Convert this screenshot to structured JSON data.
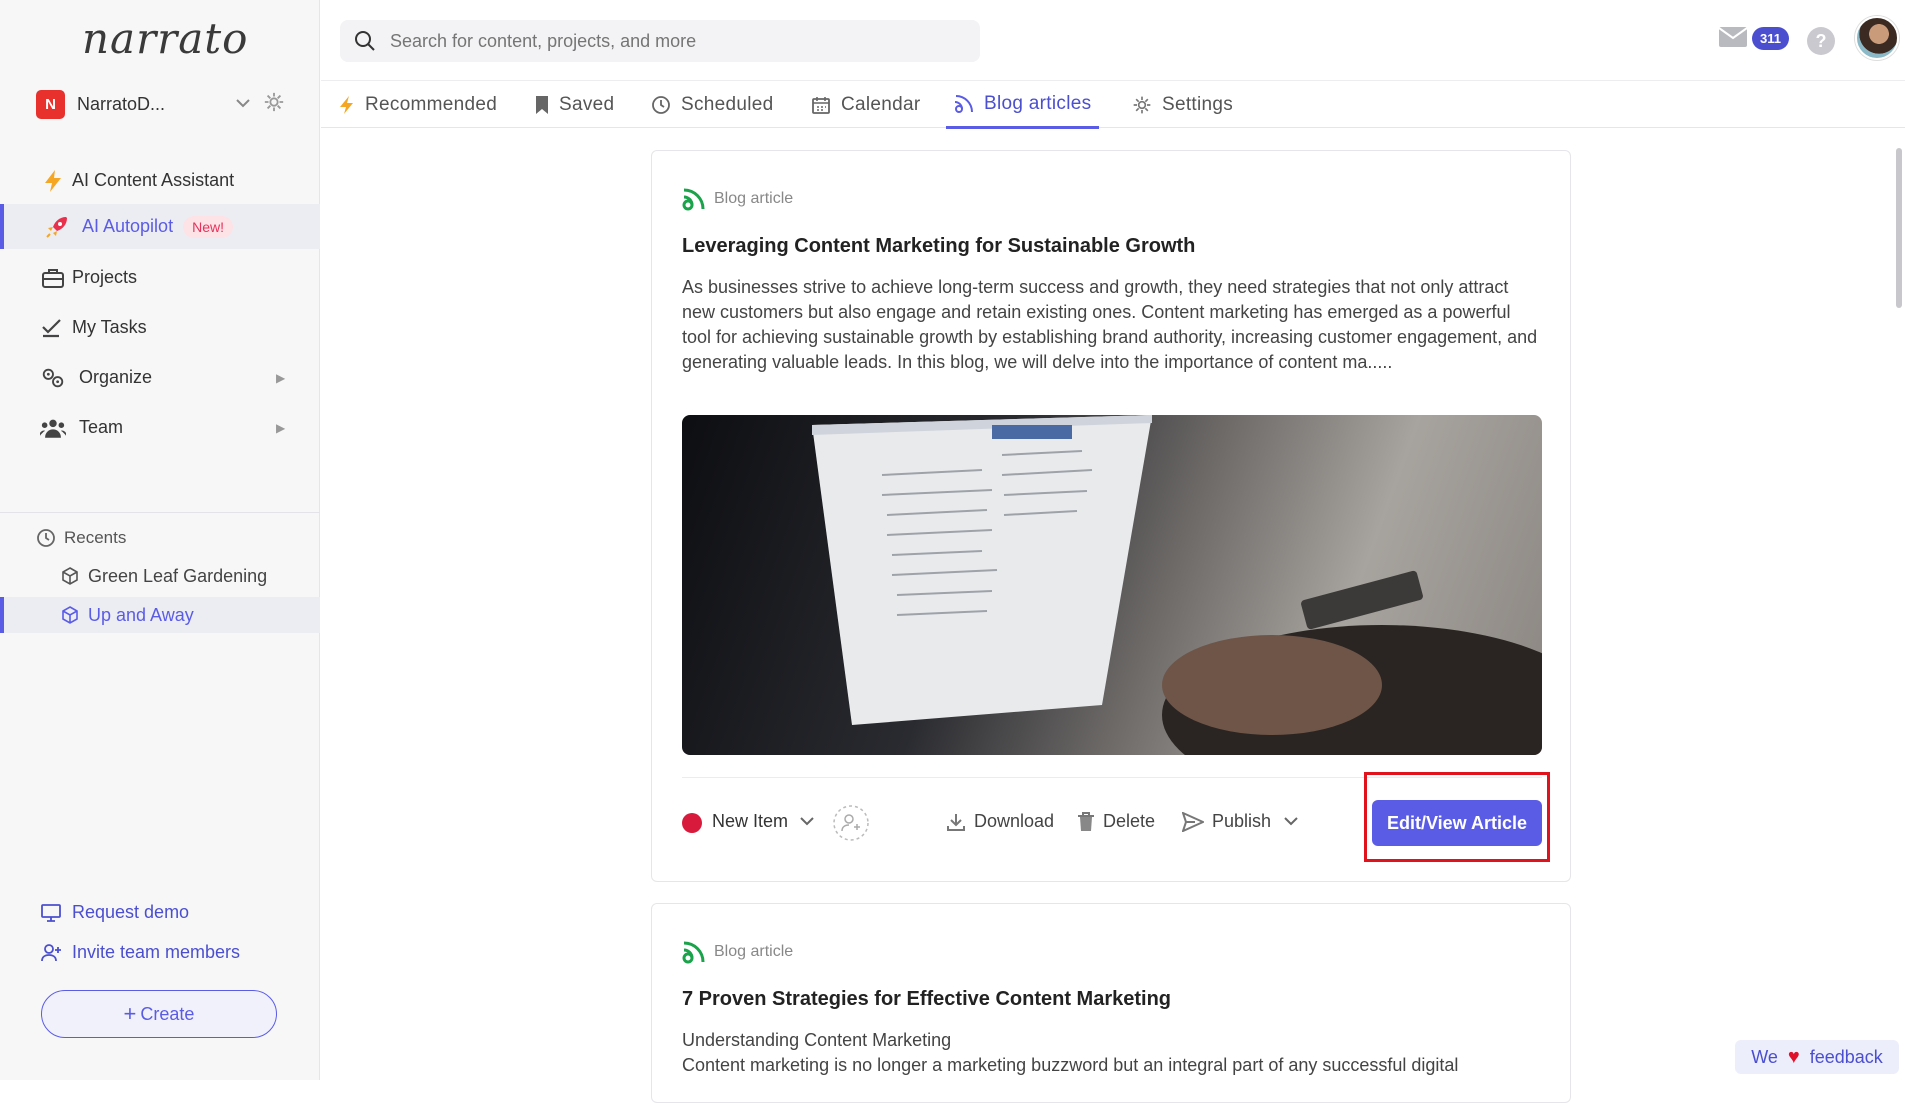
{
  "app": {
    "logo": "narrato"
  },
  "sidebar": {
    "org": {
      "initial": "N",
      "name": "NarratoD..."
    },
    "items": [
      {
        "label": "AI Content Assistant",
        "icon": "bolt-icon"
      },
      {
        "label": "AI Autopilot",
        "icon": "rocket-icon",
        "badge": "New!"
      },
      {
        "label": "Projects",
        "icon": "briefcase-icon"
      },
      {
        "label": "My Tasks",
        "icon": "checklist-icon"
      },
      {
        "label": "Organize",
        "icon": "gears-icon"
      },
      {
        "label": "Team",
        "icon": "team-icon"
      }
    ],
    "recents": {
      "title": "Recents",
      "items": [
        {
          "label": "Green Leaf Gardening"
        },
        {
          "label": "Up and Away"
        }
      ]
    },
    "links": {
      "demo": "Request demo",
      "invite": "Invite team members"
    },
    "create": "Create"
  },
  "topbar": {
    "search_placeholder": "Search for content, projects, and more",
    "mail_count": "311",
    "help": "?"
  },
  "tabs": [
    {
      "label": "Recommended"
    },
    {
      "label": "Saved"
    },
    {
      "label": "Scheduled"
    },
    {
      "label": "Calendar"
    },
    {
      "label": "Blog articles"
    },
    {
      "label": "Settings"
    }
  ],
  "cards": [
    {
      "type": "Blog article",
      "title": "Leveraging Content Marketing for Sustainable Growth",
      "text": "As businesses strive to achieve long-term success and growth, they need strategies that not only attract new customers but also engage and retain existing ones. Content marketing has emerged as a powerful tool for achieving sustainable growth by establishing brand authority, increasing customer engagement, and generating valuable leads. In this blog, we will delve into the importance of content ma.....",
      "status": "New Item",
      "actions": {
        "download": "Download",
        "delete": "Delete",
        "publish": "Publish",
        "edit": "Edit/View Article"
      }
    },
    {
      "type": "Blog article",
      "title": "7 Proven Strategies for Effective Content Marketing",
      "text_line1": "Understanding Content Marketing",
      "text_line2": "Content marketing is no longer a marketing buzzword but an integral part of any successful digital"
    }
  ],
  "feedback": {
    "pre": "We",
    "post": "feedback"
  },
  "colors": {
    "accent": "#5b5ce6",
    "status_red": "#d81b3c",
    "highlight": "#e1121c"
  }
}
